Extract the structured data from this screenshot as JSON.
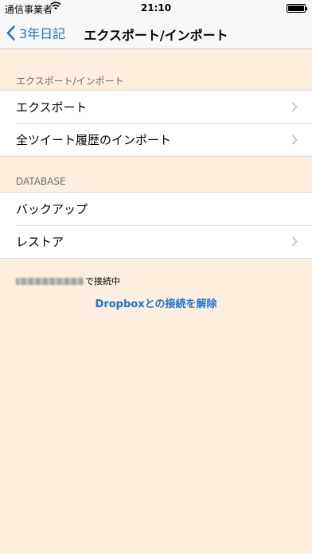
{
  "status_bar": {
    "carrier": "通信事業者",
    "time": "21:10",
    "battery_level": 1.0
  },
  "nav": {
    "back_label": "3年日記",
    "title": "エクスポート/インポート"
  },
  "sections": [
    {
      "header": "エクスポート/インポート",
      "items": [
        {
          "label": "エクスポート",
          "chevron": true
        },
        {
          "label": "全ツイート履歴のインポート",
          "chevron": true
        }
      ]
    },
    {
      "header": "DATABASE",
      "items": [
        {
          "label": "バックアップ",
          "chevron": false
        },
        {
          "label": "レストア",
          "chevron": true
        }
      ]
    }
  ],
  "dropbox": {
    "connected_suffix": "で接続中",
    "disconnect_label": "Dropboxとの接続を解除"
  },
  "colors": {
    "background": "#feeedd",
    "accent": "#1a73d9"
  }
}
